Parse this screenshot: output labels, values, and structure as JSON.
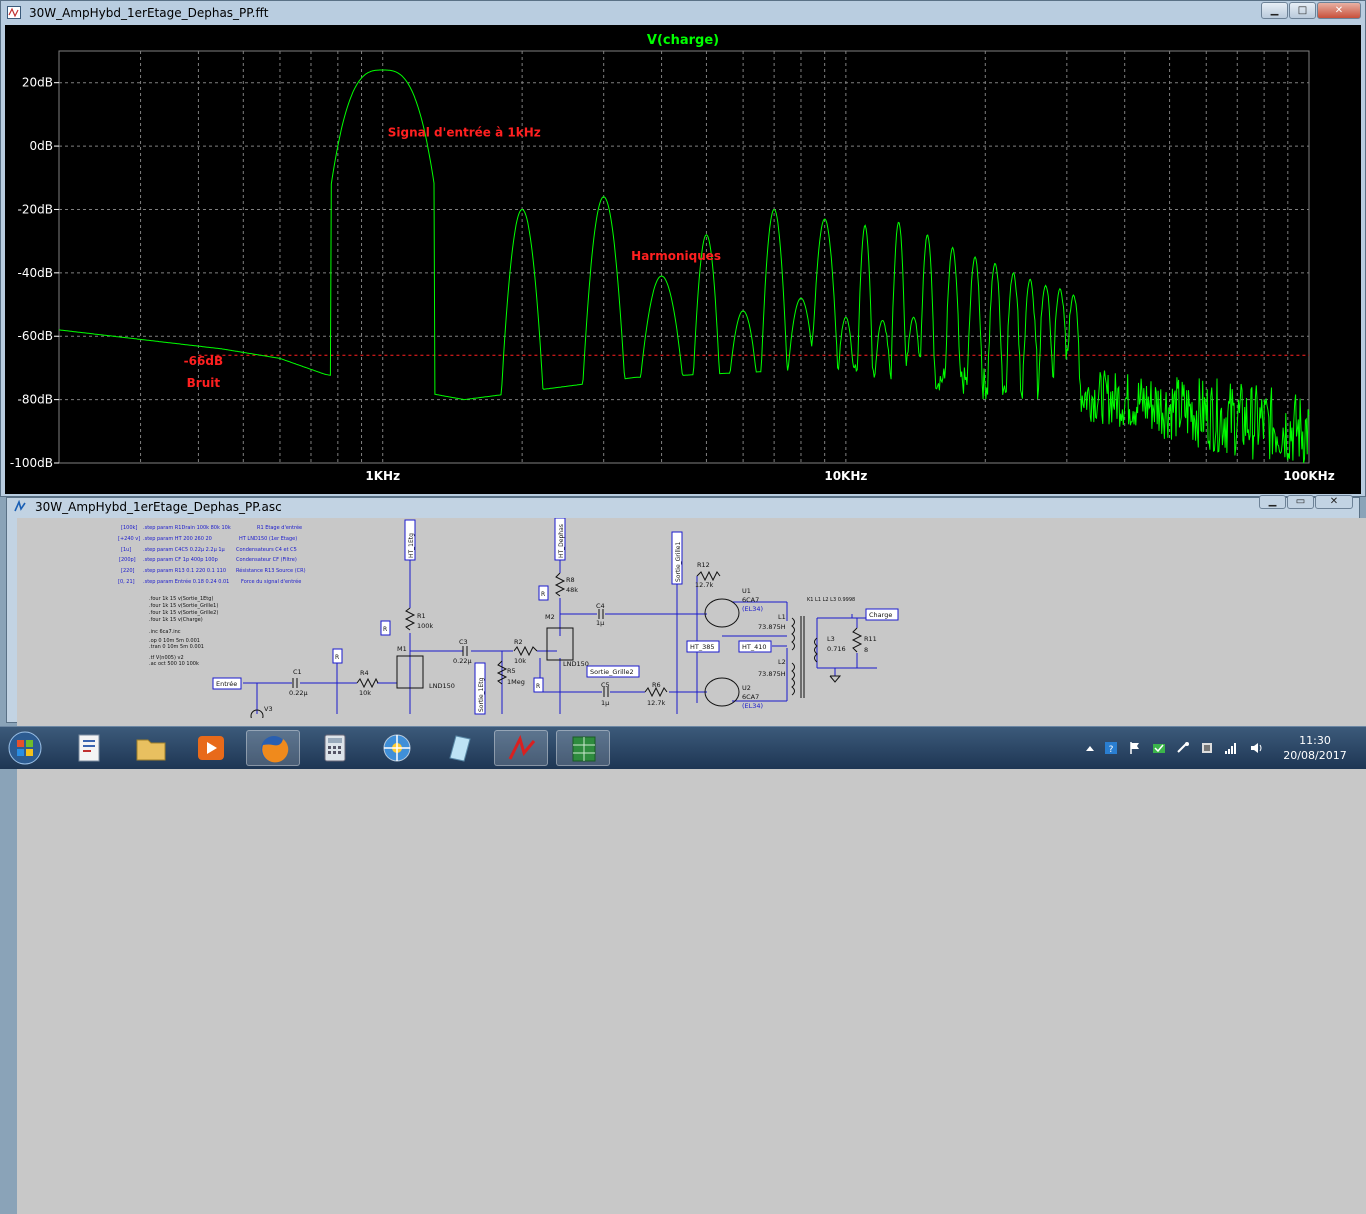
{
  "fft_window": {
    "title": "30W_AmpHybd_1erEtage_Dephas_PP.fft"
  },
  "schematic_window": {
    "title": "30W_AmpHybd_1erEtage_Dephas_PP.asc"
  },
  "chart_data": {
    "type": "line",
    "title": "V(charge)",
    "xlabel": "",
    "ylabel": "",
    "x_scale": "log",
    "xlim": [
      200,
      100000
    ],
    "ylim": [
      -100,
      30
    ],
    "x_ticks": [
      1000,
      10000,
      100000
    ],
    "x_tick_labels": [
      "1KHz",
      "10KHz",
      "100KHz"
    ],
    "y_ticks": [
      20,
      0,
      -20,
      -40,
      -60,
      -80,
      -100
    ],
    "y_tick_labels": [
      "20dB",
      "0dB",
      "-20dB",
      "-40dB",
      "-60dB",
      "-80dB",
      "-100dB"
    ],
    "grid": true,
    "background": "#000000",
    "colors": {
      "trace": "#00ff00",
      "grid": "#7f7f7f",
      "reference": "#ff2020",
      "annotation": "#ff2020",
      "title": "#00ff00"
    },
    "series": [
      {
        "name": "V(charge)",
        "fundamental": {
          "x": 1000,
          "y": 24
        },
        "harmonics": [
          {
            "x": 2000,
            "y": -20
          },
          {
            "x": 3000,
            "y": -16
          },
          {
            "x": 4000,
            "y": -41
          },
          {
            "x": 5000,
            "y": -28
          },
          {
            "x": 6000,
            "y": -52
          },
          {
            "x": 7000,
            "y": -20
          },
          {
            "x": 8000,
            "y": -48
          },
          {
            "x": 9000,
            "y": -23
          },
          {
            "x": 10000,
            "y": -54
          },
          {
            "x": 11000,
            "y": -25
          },
          {
            "x": 12000,
            "y": -55
          },
          {
            "x": 13000,
            "y": -24
          },
          {
            "x": 14000,
            "y": -54
          },
          {
            "x": 15000,
            "y": -28
          },
          {
            "x": 17000,
            "y": -32
          },
          {
            "x": 19000,
            "y": -35
          },
          {
            "x": 21000,
            "y": -37
          },
          {
            "x": 23000,
            "y": -40
          },
          {
            "x": 25000,
            "y": -42
          },
          {
            "x": 27000,
            "y": -44
          },
          {
            "x": 29000,
            "y": -45
          },
          {
            "x": 31000,
            "y": -47
          }
        ],
        "noise_floor": [
          {
            "x": 200,
            "y": -58
          },
          {
            "x": 300,
            "y": -61
          },
          {
            "x": 450,
            "y": -64
          },
          {
            "x": 600,
            "y": -67
          },
          {
            "x": 750,
            "y": -72
          },
          {
            "x": 1500,
            "y": -80
          },
          {
            "x": 3500,
            "y": -73
          },
          {
            "x": 10000,
            "y": -70
          },
          {
            "x": 40000,
            "y": -80
          },
          {
            "x": 100000,
            "y": -90
          }
        ]
      },
      {
        "name": "reference",
        "style": "dashed",
        "y": -66
      }
    ],
    "annotations": [
      {
        "text": "Signal d'entrée à 1kHz",
        "x": 1500,
        "y": 3
      },
      {
        "text": "Harmoniques",
        "x": 4300,
        "y": -36
      },
      {
        "text": "-66dB",
        "x": 410,
        "y": -69
      },
      {
        "text": "Bruit",
        "x": 410,
        "y": -76
      }
    ]
  },
  "schematic": {
    "directives": [
      {
        "value": "[100k]",
        "text": ".step param R1Drain 100k 80k 10k",
        "comment": "R1 Etage d'entrée"
      },
      {
        "value": "[+240 v]",
        "text": ".step param HT 200 260 20",
        "comment": "HT LND150 (1er Etage)"
      },
      {
        "value": "[1u]",
        "text": ".step param C4C5 0.22µ 2.2µ 1µ",
        "comment": "Condensateurs C4 et C5"
      },
      {
        "value": "[200p]",
        "text": ".step param CF 1p 400p 100p",
        "comment": "Condensateur CF (Filtre)"
      },
      {
        "value": "[220]",
        "text": ".step param R13 0.1 220 0.1 110",
        "comment": "Résistance R13 Source (CR)"
      },
      {
        "value": "[0, 21]",
        "text": ".step param Entrée 0.18 0.24 0.01",
        "comment": "Force du signal d'entrée"
      }
    ],
    "four_lines": [
      ".four 1k 15 v(Sortie_1Etg)",
      ".four 1k 15 v(Sortie_Grille1)",
      ".four 1k 15 v(Sortie_Grille2)",
      ".four 1k 15 v(Charge)"
    ],
    "inc_line": ".inc 6ca7.inc",
    "op_lines": [
      ".op 0 10m 5m 0.001",
      ".tran 0 10m 5m 0.001"
    ],
    "tf_lines": [
      ".tf V(n005) v2",
      ".ac oct 500 10 100k"
    ],
    "labels": {
      "r1": "R1",
      "r1_val": "100k",
      "m1": "M1",
      "m1_part": "LND150",
      "c1": "C1",
      "c1_val": "0.22µ",
      "r4": "R4",
      "r4_val": "10k",
      "v3": "V3",
      "c3": "C3",
      "c3_val": "0.22µ",
      "r2": "R2",
      "r2_val": "10k",
      "r5": "R5",
      "r5_val": "1Meg",
      "r8": "R8",
      "r8_val": "48k",
      "m2": "M2",
      "m2_part": "LND150",
      "c4": "C4",
      "c4_val": "1µ",
      "c5": "C5",
      "c5_val": "1µ",
      "r6": "R6",
      "r6_val": "12.7k",
      "r12": "R12",
      "r12_val": "12.7k",
      "u1": "U1",
      "u1_part": "6CA7",
      "u1_alt": "(EL34)",
      "u2": "U2",
      "u2_part": "6CA7",
      "u2_alt": "(EL34)",
      "l1": "L1",
      "l1_val": "73.875H",
      "l2": "L2",
      "l2_val": "73.875H",
      "l3": "L3",
      "l3_val": "0.716",
      "r11": "R11",
      "r11_val": "8",
      "k1": "K1 L1 L2 L3 0.9998",
      "ht_1etg": "HT_1Etg",
      "ht_dephas": "HT_Dephas",
      "sortie_grille1": "Sortie_Grille1",
      "sortie_grille2": "Sortie_Grille2",
      "sortie_1etg": "Sortie_1Etg",
      "ht_385": "HT_385",
      "ht_410": "HT_410",
      "charge": "Charge",
      "entree": "Entrée",
      "tag_r": "R"
    }
  },
  "taskbar": {
    "apps": [
      {
        "name": "start",
        "icon": "windows-logo-icon"
      },
      {
        "name": "word",
        "icon": "document-icon"
      },
      {
        "name": "explorer",
        "icon": "folder-icon"
      },
      {
        "name": "media",
        "icon": "media-player-icon"
      },
      {
        "name": "firefox",
        "icon": "firefox-icon"
      },
      {
        "name": "calculator",
        "icon": "calculator-icon"
      },
      {
        "name": "network",
        "icon": "network-icon"
      },
      {
        "name": "notes",
        "icon": "notes-icon"
      },
      {
        "name": "ltspice",
        "icon": "ltspice-icon"
      },
      {
        "name": "excel",
        "icon": "spreadsheet-icon"
      }
    ],
    "time": "11:30",
    "date": "20/08/2017"
  }
}
